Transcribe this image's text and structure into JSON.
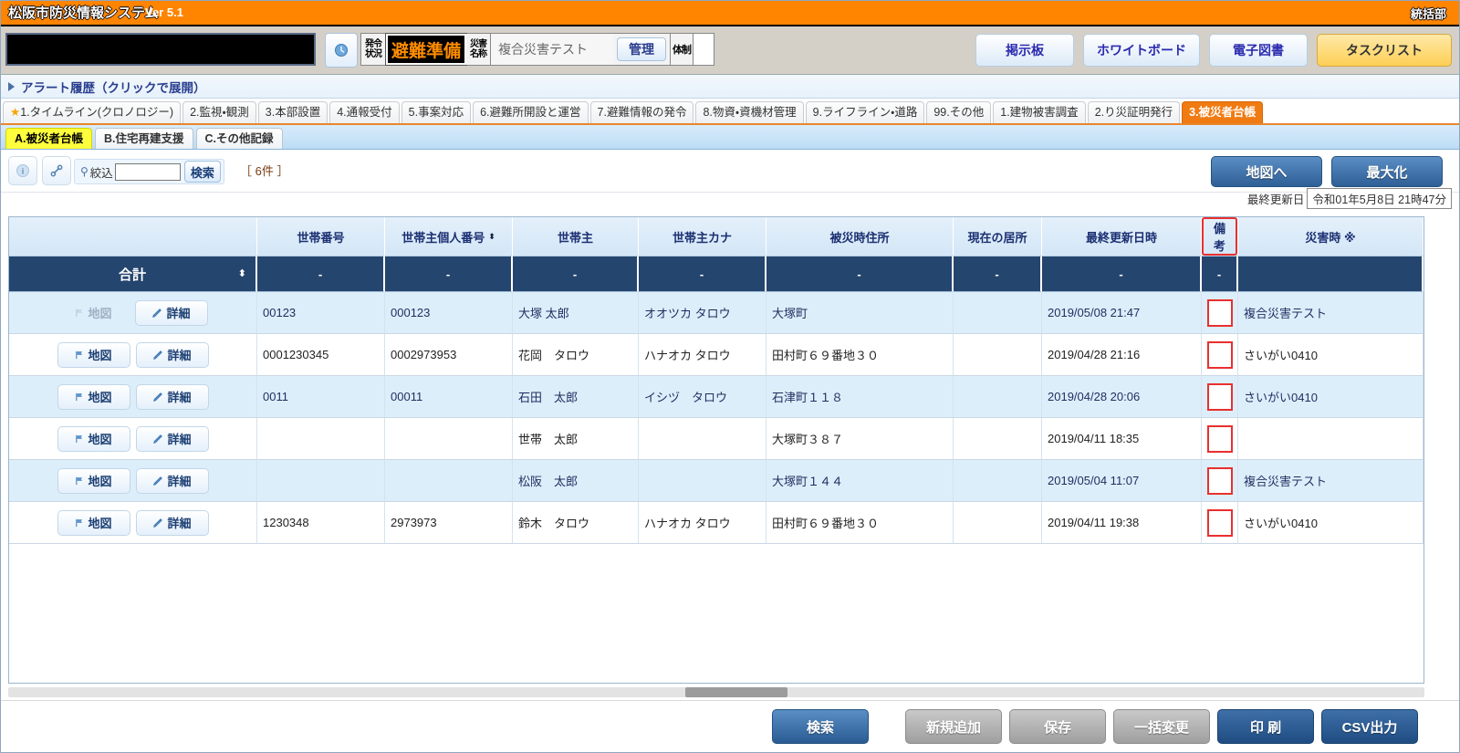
{
  "titlebar": {
    "system_name": "松阪市防災情報システム",
    "version": "Ver 5.1",
    "department": "統括部"
  },
  "controlbar": {
    "ticker_text": "",
    "clock_icon": "clock-icon",
    "status_label": "発令状況",
    "status_label_line1": "発令",
    "status_label_line2": "状況",
    "status_value": "避難準備",
    "disaster_label_line1": "災害",
    "disaster_label_line2": "名称",
    "disaster_name": "複合災害テスト",
    "manage_button": "管理",
    "taisei_label": "体制",
    "top_buttons": [
      {
        "label": "掲示板",
        "name": "bulletin-board-button"
      },
      {
        "label": "ホワイトボード",
        "name": "whiteboard-button"
      },
      {
        "label": "電子図書",
        "name": "e-library-button"
      },
      {
        "label": "タスクリスト",
        "name": "task-list-button"
      }
    ]
  },
  "alert_bar": {
    "label": "アラート履歴（クリックで展開）"
  },
  "main_tabs": [
    {
      "star": "★",
      "label": "1.タイムライン(クロノロジー)",
      "active": false
    },
    {
      "star": "",
      "label": "2.監視・観測",
      "active": false
    },
    {
      "star": "",
      "label": "3.本部設置",
      "active": false
    },
    {
      "star": "",
      "label": "4.通報受付",
      "active": false
    },
    {
      "star": "",
      "label": "5.事案対応",
      "active": false
    },
    {
      "star": "",
      "label": "6.避難所開設と運営",
      "active": false
    },
    {
      "star": "",
      "label": "7.避難情報の発令",
      "active": false
    },
    {
      "star": "",
      "label": "8.物資・資機材管理",
      "active": false
    },
    {
      "star": "",
      "label": "9.ライフライン・道路",
      "active": false
    },
    {
      "star": "",
      "label": "99.その他",
      "active": false
    },
    {
      "star": "",
      "label": "1.建物被害調査",
      "active": false
    },
    {
      "star": "",
      "label": "2.り災証明発行",
      "active": false
    },
    {
      "star": "",
      "label": "3.被災者台帳",
      "active": true
    }
  ],
  "sub_tabs": [
    {
      "label": "A.被災者台帳",
      "active": true
    },
    {
      "label": "B.住宅再建支援",
      "active": false
    },
    {
      "label": "C.その他記録",
      "active": false
    }
  ],
  "work_toolbar": {
    "info_icon": "info-icon",
    "link_icon": "link-icon",
    "filter_icon": "search-icon",
    "filter_label": "絞込",
    "filter_value": "",
    "filter_placeholder": "",
    "search_small_label": "検索",
    "count_label": "［ 6件 ］",
    "map_button": "地図へ",
    "maximize_button": "最大化",
    "last_update_label": "最終更新日",
    "last_update_value": "令和01年5月8日 21時47分"
  },
  "table": {
    "columns": [
      {
        "label": "",
        "name": "actions",
        "marked": false,
        "sortable": false
      },
      {
        "label": "世帯番号",
        "name": "household-number",
        "marked": false,
        "sortable": false
      },
      {
        "label": "世帯主個人番号",
        "name": "head-personal-number",
        "marked": false,
        "sortable": true
      },
      {
        "label": "世帯主",
        "name": "household-head",
        "marked": false,
        "sortable": false
      },
      {
        "label": "世帯主カナ",
        "name": "household-head-kana",
        "marked": false,
        "sortable": false
      },
      {
        "label": "被災時住所",
        "name": "address-at-disaster",
        "marked": false,
        "sortable": false
      },
      {
        "label": "現在の居所",
        "name": "current-location",
        "marked": false,
        "sortable": false
      },
      {
        "label": "最終更新日時",
        "name": "last-updated",
        "marked": false,
        "sortable": false
      },
      {
        "label": "備考",
        "name": "remarks",
        "marked": true,
        "sortable": false
      },
      {
        "label": "災害時 ※",
        "name": "disaster-time",
        "marked": false,
        "sortable": false
      }
    ],
    "total_row": {
      "label": "合計",
      "values": [
        "-",
        "-",
        "-",
        "-",
        "-",
        "-",
        "-",
        "-",
        ""
      ]
    },
    "row_buttons": {
      "map": "地図",
      "detail": "詳細"
    },
    "rows": [
      {
        "map_disabled": true,
        "household_number": "00123",
        "head_personal_number": "000123",
        "household_head": "大塚 太郎",
        "household_head_kana": "オオツカ タロウ",
        "address_at_disaster": "大塚町",
        "current_location": "",
        "last_updated": "2019/05/08 21:47",
        "remarks": "",
        "disaster_time": "複合災害テスト"
      },
      {
        "map_disabled": false,
        "household_number": "0001230345",
        "head_personal_number": "0002973953",
        "household_head": "花岡　タロウ",
        "household_head_kana": "ハナオカ タロウ",
        "address_at_disaster": "田村町６９番地３０",
        "current_location": "",
        "last_updated": "2019/04/28 21:16",
        "remarks": "",
        "disaster_time": "さいがい0410"
      },
      {
        "map_disabled": false,
        "household_number": "0011",
        "head_personal_number": "00011",
        "household_head": "石田　太郎",
        "household_head_kana": "イシヅ　タロウ",
        "address_at_disaster": "石津町１１８",
        "current_location": "",
        "last_updated": "2019/04/28 20:06",
        "remarks": "",
        "disaster_time": "さいがい0410"
      },
      {
        "map_disabled": false,
        "household_number": "",
        "head_personal_number": "",
        "household_head": "世帯　太郎",
        "household_head_kana": "",
        "address_at_disaster": "大塚町３８７",
        "current_location": "",
        "last_updated": "2019/04/11 18:35",
        "remarks": "",
        "disaster_time": ""
      },
      {
        "map_disabled": false,
        "household_number": "",
        "head_personal_number": "",
        "household_head": "松阪　太郎",
        "household_head_kana": "",
        "address_at_disaster": "大塚町１４４",
        "current_location": "",
        "last_updated": "2019/05/04 11:07",
        "remarks": "",
        "disaster_time": "複合災害テスト"
      },
      {
        "map_disabled": false,
        "household_number": "1230348",
        "head_personal_number": "2973973",
        "household_head": "鈴木　タロウ",
        "household_head_kana": "ハナオカ タロウ",
        "address_at_disaster": "田村町６９番地３０",
        "current_location": "",
        "last_updated": "2019/04/11 19:38",
        "remarks": "",
        "disaster_time": "さいがい0410"
      }
    ]
  },
  "bottom_buttons": [
    {
      "label": "検索",
      "style": "blue",
      "name": "search-button"
    },
    {
      "label": "新規追加",
      "style": "gray",
      "name": "add-new-button"
    },
    {
      "label": "保存",
      "style": "gray",
      "name": "save-button"
    },
    {
      "label": "一括変更",
      "style": "gray",
      "name": "bulk-change-button"
    },
    {
      "label": "印  刷",
      "style": "navy",
      "name": "print-button"
    },
    {
      "label": "CSV出力",
      "style": "navy",
      "name": "csv-export-button"
    }
  ],
  "colors": {
    "brand_orange": "#ff8400",
    "header_navy": "#24456e",
    "accent_red": "#e8302f",
    "status_amber": "#ff8c00",
    "tab_active_yellow": "#ffff3d"
  }
}
